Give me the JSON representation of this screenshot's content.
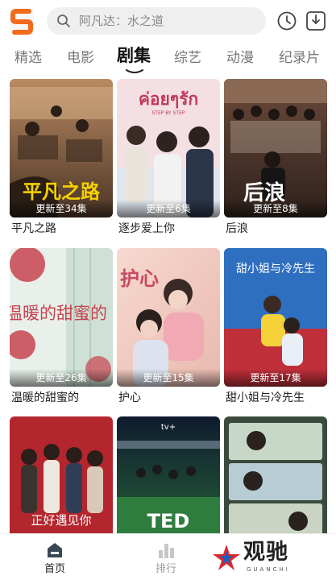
{
  "search": {
    "placeholder": "阿凡达：水之道"
  },
  "tabs": [
    {
      "label": "精选"
    },
    {
      "label": "电影"
    },
    {
      "label": "剧集"
    },
    {
      "label": "综艺"
    },
    {
      "label": "动漫"
    },
    {
      "label": "纪录片"
    }
  ],
  "active_tab": "剧集",
  "cards": [
    {
      "title": "平凡之路",
      "episode": "更新至34集",
      "art_text": "平凡之路"
    },
    {
      "title": "逐步爱上你",
      "episode": "更新至6集",
      "art_text": "ค่อยๆรัก",
      "art_sub": "STEP BY STEP"
    },
    {
      "title": "后浪",
      "episode": "更新至8集",
      "art_text": "后浪"
    },
    {
      "title": "温暖的甜蜜的",
      "episode": "更新至26集",
      "art_text": "温暖的甜蜜的"
    },
    {
      "title": "护心",
      "episode": "更新至15集",
      "art_text": "护心"
    },
    {
      "title": "甜小姐与冷先生",
      "episode": "更新至17集",
      "art_text": "甜小姐与冷先生"
    },
    {
      "title": "",
      "episode": "",
      "art_text": "正好遇见你"
    },
    {
      "title": "",
      "episode": "",
      "art_text": "TED",
      "art_sub": "tv+"
    },
    {
      "title": "",
      "episode": "",
      "art_text": ""
    }
  ],
  "bottom_nav": [
    {
      "label": "首页",
      "active": true
    },
    {
      "label": "排行",
      "active": false
    }
  ],
  "brand": {
    "name": "观驰",
    "sub": "GUANCHI"
  },
  "colors": {
    "accent": "#f26a1b",
    "text": "#222222",
    "muted": "#777777"
  }
}
